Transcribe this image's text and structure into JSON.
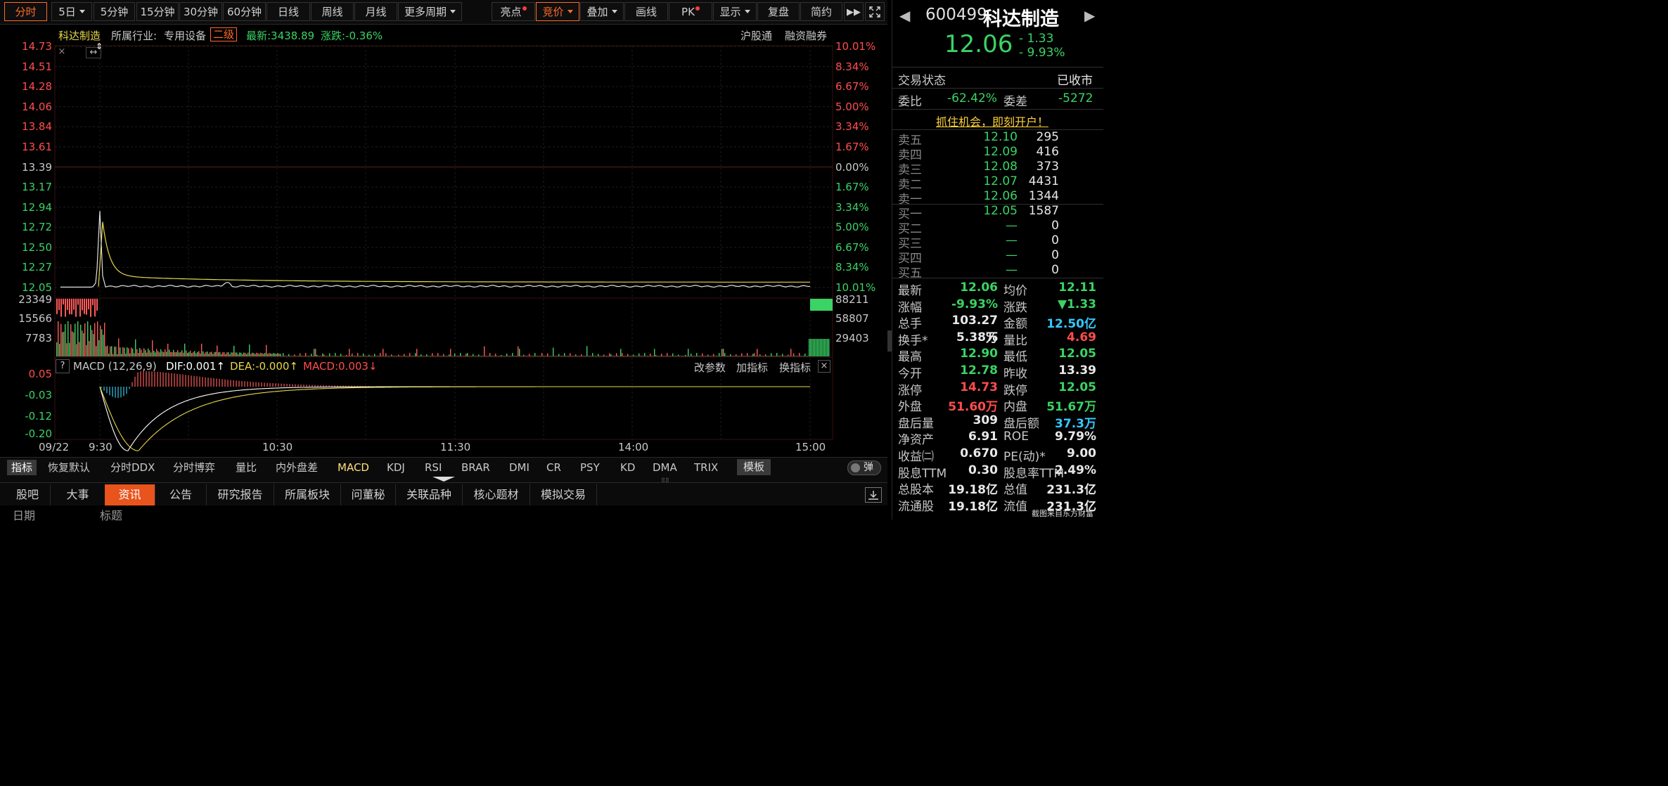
{
  "toolbar": {
    "periods": [
      "分时",
      "5日",
      "5分钟",
      "15分钟",
      "30分钟",
      "60分钟",
      "日线",
      "周线",
      "月线",
      "更多周期"
    ],
    "tools": [
      "亮点",
      "竞价",
      "叠加",
      "画线",
      "PK",
      "显示",
      "复盘",
      "简约"
    ],
    "active_period": "分时",
    "active_tool": "竞价"
  },
  "info": {
    "stock_name": "科达制造",
    "industry_label": "所属行业:",
    "industry": "专用设备",
    "industry_level": "二级",
    "latest": "最新:3438.89",
    "change": "涨跌:-0.36%",
    "links": [
      "沪股通",
      "融资融券"
    ]
  },
  "price_axis": {
    "left": [
      "14.73",
      "14.51",
      "14.28",
      "14.06",
      "13.84",
      "13.61",
      "13.39",
      "13.17",
      "12.94",
      "12.72",
      "12.50",
      "12.27",
      "12.05"
    ],
    "right": [
      "10.01%",
      "8.34%",
      "6.67%",
      "5.00%",
      "3.34%",
      "1.67%",
      "0.00%",
      "1.67%",
      "3.34%",
      "5.00%",
      "6.67%",
      "8.34%",
      "10.01%"
    ]
  },
  "volume_axis": {
    "left": [
      "23349",
      "15566",
      "7783"
    ],
    "right": [
      "88211",
      "58807",
      "29403"
    ]
  },
  "macd": {
    "help": "?",
    "title": "MACD (12,26,9)",
    "dif": "DIF:0.001↑",
    "dea": "DEA:-0.000↑",
    "macd": "MACD:0.003↓",
    "actions": [
      "改参数",
      "加指标",
      "换指标"
    ],
    "axis": [
      "0.05",
      "-0.03",
      "-0.12",
      "-0.20"
    ]
  },
  "time_axis": [
    "09/22",
    "9:30",
    "10:30",
    "11:30",
    "14:00",
    "15:00"
  ],
  "indicators": {
    "items": [
      "指标",
      "恢复默认",
      "分时DDX",
      "分时博弈",
      "量比",
      "内外盘差",
      "MACD",
      "KDJ",
      "RSI",
      "BRAR",
      "DMI",
      "CR",
      "PSY",
      "KD",
      "DMA",
      "TRIX"
    ],
    "template": "模板",
    "toggle": "弹",
    "active": "MACD"
  },
  "bottom_tabs": {
    "items": [
      "股吧",
      "大事",
      "资讯",
      "公告",
      "研究报告",
      "所属板块",
      "问董秘",
      "关联品种",
      "核心题材",
      "模拟交易"
    ],
    "active": "资讯",
    "list_headers": [
      "日期",
      "标题"
    ]
  },
  "quote": {
    "code": "600499",
    "name": "科达制造",
    "price": "12.06",
    "change": "- 1.33",
    "change_pct": "- 9.93%",
    "status_label": "交易状态",
    "status": "已收市",
    "wb_label": "委比",
    "wb": "-62.42%",
    "wc_label": "委差",
    "wc": "-5272",
    "promo": "抓住机会，即刻开户！",
    "asks": [
      {
        "label": "卖五",
        "price": "12.10",
        "vol": "295"
      },
      {
        "label": "卖四",
        "price": "12.09",
        "vol": "416"
      },
      {
        "label": "卖三",
        "price": "12.08",
        "vol": "373"
      },
      {
        "label": "卖二",
        "price": "12.07",
        "vol": "4431"
      },
      {
        "label": "卖一",
        "price": "12.06",
        "vol": "1344"
      }
    ],
    "bids": [
      {
        "label": "买一",
        "price": "12.05",
        "vol": "1587"
      },
      {
        "label": "买二",
        "price": "—",
        "vol": "0"
      },
      {
        "label": "买三",
        "price": "—",
        "vol": "0"
      },
      {
        "label": "买四",
        "price": "—",
        "vol": "0"
      },
      {
        "label": "买五",
        "price": "—",
        "vol": "0"
      }
    ],
    "stats": [
      {
        "l1": "最新",
        "v1": "12.06",
        "c1": "g",
        "l2": "均价",
        "v2": "12.11",
        "c2": "g"
      },
      {
        "l1": "涨幅",
        "v1": "-9.93%",
        "c1": "g",
        "l2": "涨跌",
        "v2": "▼1.33",
        "c2": "g"
      },
      {
        "l1": "总手",
        "v1": "103.27万",
        "c1": "w",
        "l2": "金额",
        "v2": "12.50亿",
        "c2": "c"
      },
      {
        "l1": "换手*",
        "v1": "5.38%",
        "c1": "w",
        "l2": "量比",
        "v2": "4.69",
        "c2": "r"
      },
      {
        "l1": "最高",
        "v1": "12.90",
        "c1": "g",
        "l2": "最低",
        "v2": "12.05",
        "c2": "g"
      },
      {
        "l1": "今开",
        "v1": "12.78",
        "c1": "g",
        "l2": "昨收",
        "v2": "13.39",
        "c2": "w"
      },
      {
        "l1": "涨停",
        "v1": "14.73",
        "c1": "r",
        "l2": "跌停",
        "v2": "12.05",
        "c2": "g"
      },
      {
        "l1": "外盘",
        "v1": "51.60万",
        "c1": "r",
        "l2": "内盘",
        "v2": "51.67万",
        "c2": "g"
      },
      {
        "l1": "盘后量",
        "v1": "309",
        "c1": "w",
        "l2": "盘后额",
        "v2": "37.3万",
        "c2": "c"
      },
      {
        "l1": "净资产",
        "v1": "6.91",
        "c1": "w",
        "l2": "ROE",
        "v2": "9.79%",
        "c2": "w"
      },
      {
        "l1": "收益㈡",
        "v1": "0.670",
        "c1": "w",
        "l2": "PE(动)*",
        "v2": "9.00",
        "c2": "w"
      },
      {
        "l1": "股息TTM",
        "v1": "0.30",
        "c1": "w",
        "l2": "股息率TTM",
        "v2": "2.49%",
        "c2": "w"
      },
      {
        "l1": "总股本",
        "v1": "19.18亿",
        "c1": "w",
        "l2": "总值",
        "v2": "231.3亿",
        "c2": "w"
      },
      {
        "l1": "流通股",
        "v1": "19.18亿",
        "c1": "w",
        "l2": "流值",
        "v2": "231.3亿",
        "c2": "w"
      }
    ],
    "watermark": "截图来自东方财富"
  },
  "colors": {
    "up": "#ff4d4d",
    "down": "#3ad364",
    "accent": "#ff6a2a",
    "price_line": "#e0e0e0",
    "avg_line": "#e6d84a"
  }
}
